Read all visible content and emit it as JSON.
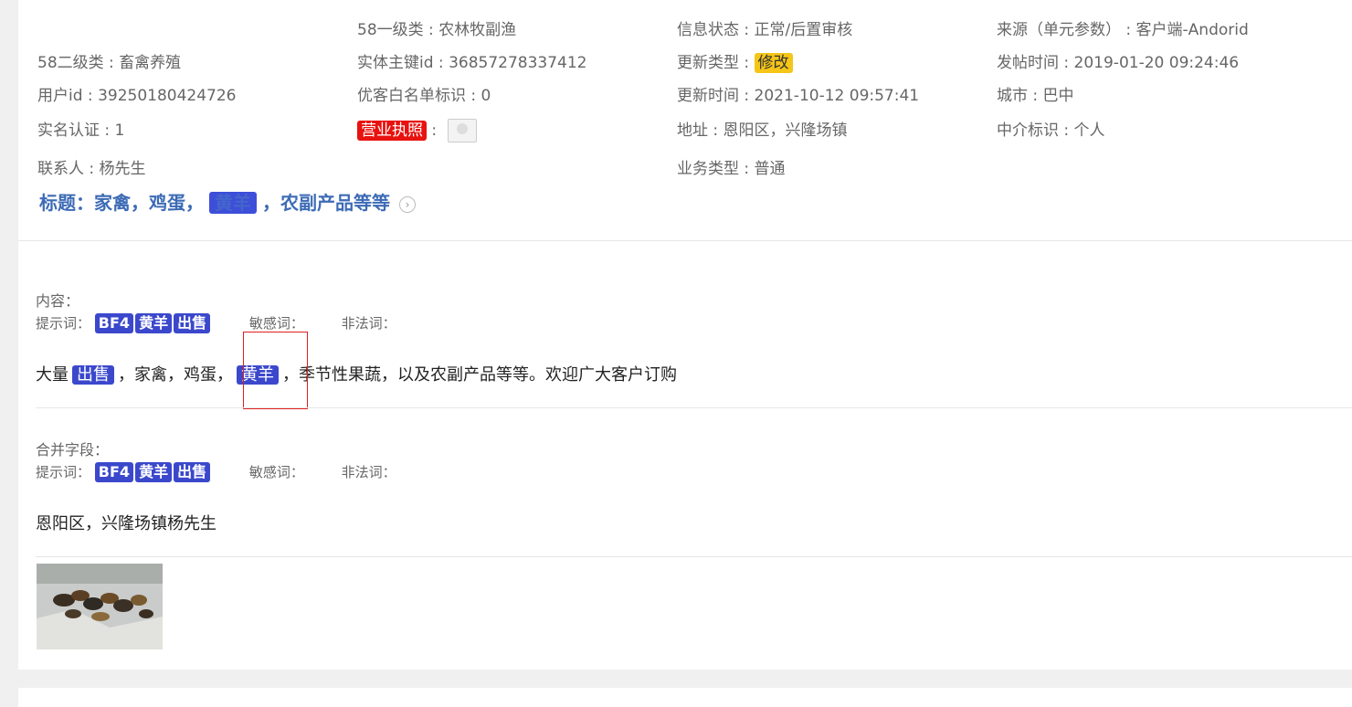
{
  "fields": {
    "cat1": {
      "key": "58一级类",
      "value": "农林牧副渔"
    },
    "info_status": {
      "key": "信息状态",
      "value": "正常/后置审核"
    },
    "source": {
      "key": "来源（单元参数）",
      "value": "客户端-Andorid"
    },
    "cat2": {
      "key": "58二级类",
      "value": "畜禽养殖"
    },
    "entity_id": {
      "key": "实体主键id",
      "value": "36857278337412"
    },
    "update_type": {
      "key": "更新类型",
      "value": "修改"
    },
    "post_time": {
      "key": "发帖时间",
      "value": "2019-01-20 09:24:46"
    },
    "user_id": {
      "key": "用户id",
      "value": "39250180424726"
    },
    "whitelist": {
      "key": "优客白名单标识",
      "value": "0"
    },
    "update_time": {
      "key": "更新时间",
      "value": "2021-10-12 09:57:41"
    },
    "city": {
      "key": "城市",
      "value": "巴中"
    },
    "realname": {
      "key": "实名认证",
      "value": "1"
    },
    "license": {
      "key": "营业执照"
    },
    "address": {
      "key": "地址",
      "value": "恩阳区，兴隆场镇"
    },
    "agent": {
      "key": "中介标识",
      "value": "个人"
    },
    "contact": {
      "key": "联系人",
      "value": "杨先生"
    },
    "biz_type": {
      "key": "业务类型",
      "value": "普通"
    }
  },
  "title": {
    "label": "标题：",
    "part1": "家禽，鸡蛋，",
    "highlight": "黄羊",
    "part2": "，农副产品等等"
  },
  "content": {
    "label": "内容：",
    "hint_label": "提示词：",
    "tags": [
      "BF4",
      "黄羊",
      "出售"
    ],
    "sensitive_label": "敏感词：",
    "illegal_label": "非法词：",
    "text_a": "大量",
    "hl1": "出售",
    "text_b": "，家禽，鸡蛋，",
    "hl2": "黄羊",
    "text_c": "，季节性果蔬，以及农副产品等等。欢迎广大客户订购"
  },
  "merged": {
    "label": "合并字段：",
    "hint_label": "提示词：",
    "tags": [
      "BF4",
      "黄羊",
      "出售"
    ],
    "sensitive_label": "敏感词：",
    "illegal_label": "非法词：",
    "text": "恩阳区，兴隆场镇杨先生"
  }
}
